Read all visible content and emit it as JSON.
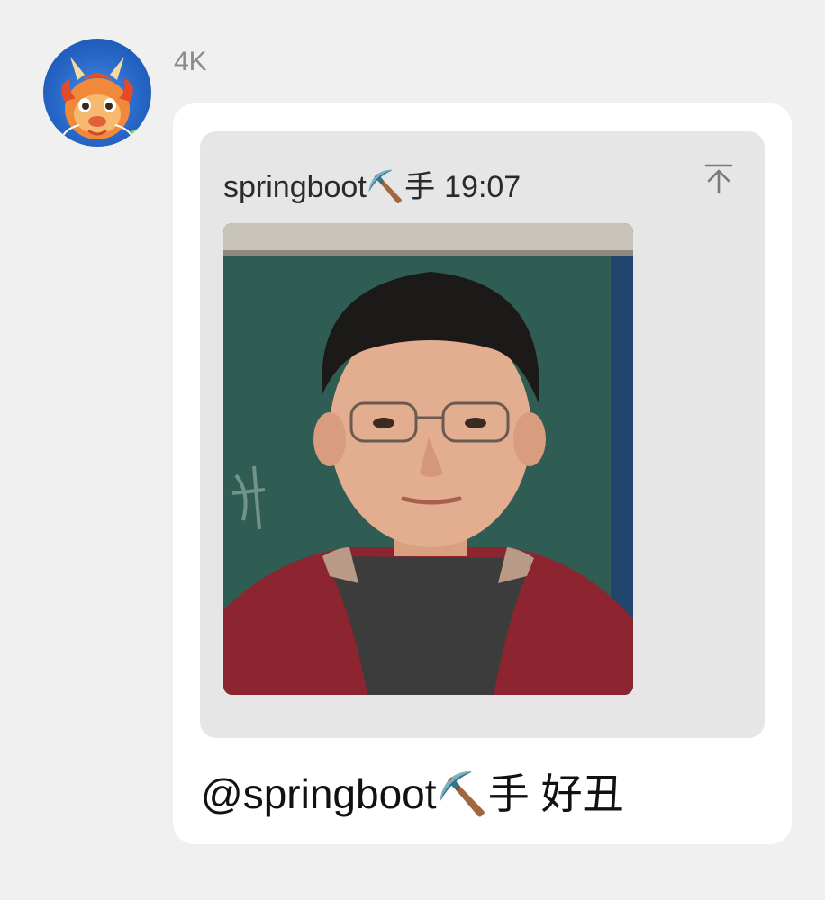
{
  "message": {
    "sender_name": "4K",
    "avatar_icon": "dragon-avatar-icon",
    "quote": {
      "author": "springboot⛏️手",
      "time": "19:07",
      "action_icon": "scroll-to-top-icon",
      "image_icon": "person-photo-image"
    },
    "text": "@springboot⛏️手 好丑"
  },
  "colors": {
    "page_background": "#f0f0f0",
    "bubble_background": "#ffffff",
    "quote_background": "#e6e6e6",
    "sender_name": "#8a8a8f"
  }
}
